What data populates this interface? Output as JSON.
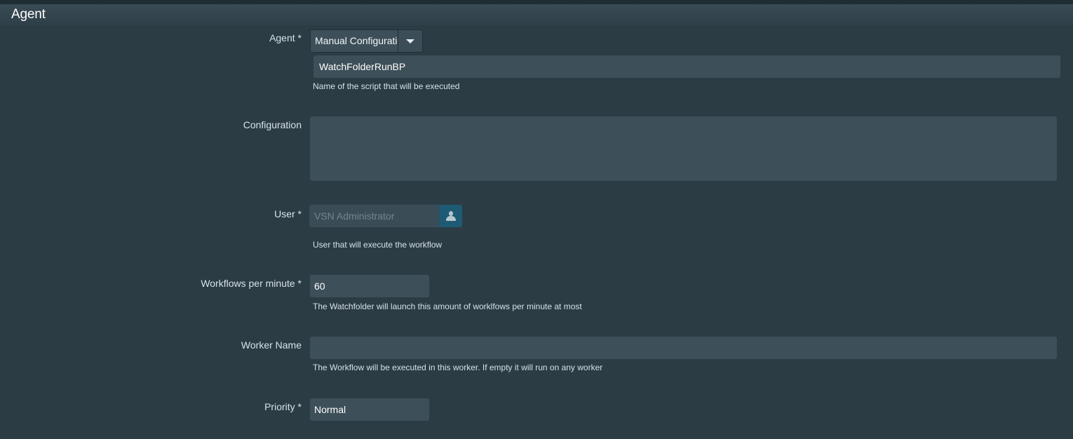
{
  "section": {
    "title": "Agent"
  },
  "agent": {
    "label": "Agent *",
    "select_value": "Manual Configuration",
    "script_name": "WatchFolderRunBP",
    "help": "Name of the script that will be executed"
  },
  "configuration": {
    "label": "Configuration",
    "value": ""
  },
  "user": {
    "label": "User *",
    "placeholder": "VSN Administrator",
    "help": "User that will execute the workflow",
    "icon": "user-icon",
    "button_color": "#1e5a73"
  },
  "workflows_per_minute": {
    "label": "Workflows per minute *",
    "value": "60",
    "help": "The Watchfolder will launch this amount of worklfows per minute at most"
  },
  "worker_name": {
    "label": "Worker Name",
    "value": "",
    "help": "The Workflow will be executed in this worker. If empty it will run on any worker"
  },
  "priority": {
    "label": "Priority *",
    "value": "Normal"
  },
  "colors": {
    "background": "#2b3c45",
    "field": "#3d4f58",
    "header": "#3a4b55"
  }
}
